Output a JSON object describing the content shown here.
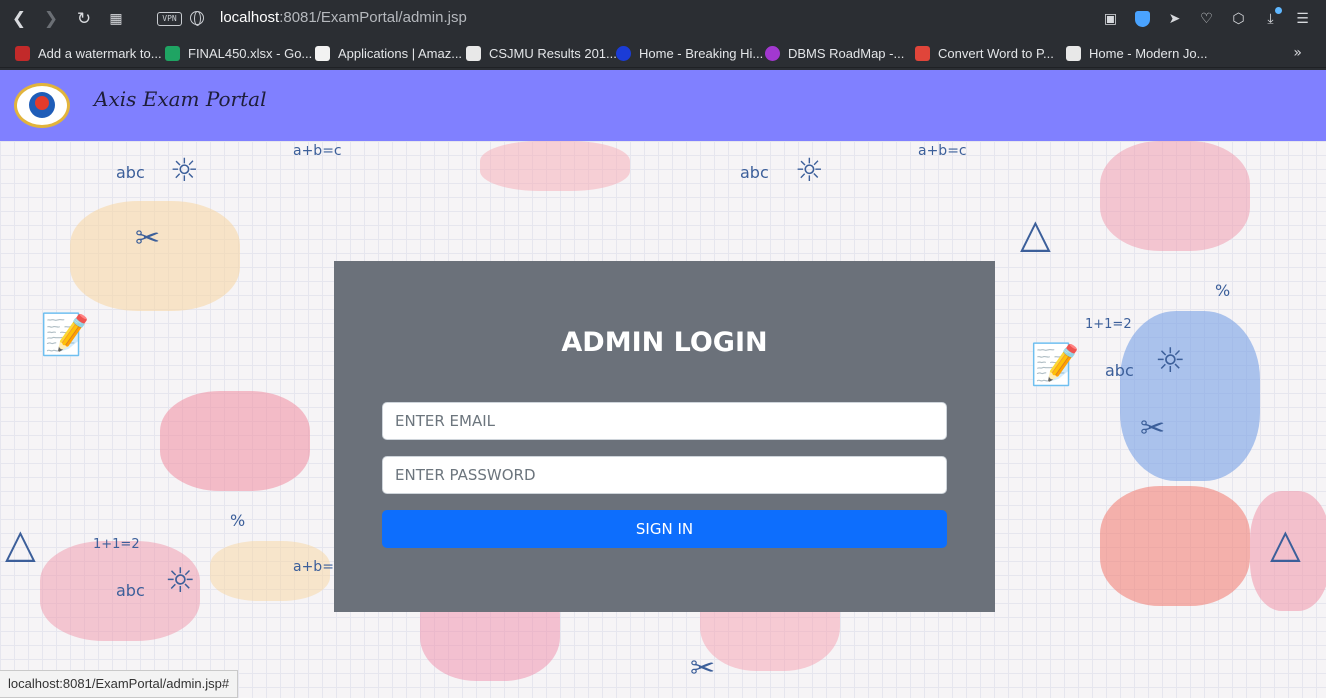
{
  "browser": {
    "url_host": "localhost",
    "url_rest": ":8081/ExamPortal/admin.jsp",
    "vpn_label": "VPN",
    "bookmarks": [
      {
        "label": "Add a watermark to...",
        "icon_color": "#c22a2a"
      },
      {
        "label": "FINAL450.xlsx - Go...",
        "icon_color": "#1fa463"
      },
      {
        "label": "Applications | Amaz...",
        "icon_color": "#f2f2f2"
      },
      {
        "label": "CSJMU Results 201...",
        "icon_color": "#e8e8e8"
      },
      {
        "label": "Home - Breaking Hi...",
        "icon_color": "#1b3cd6"
      },
      {
        "label": "DBMS RoadMap -...",
        "icon_color": "#a238d0"
      },
      {
        "label": "Convert Word to P...",
        "icon_color": "#e0453a"
      },
      {
        "label": "Home - Modern Jo...",
        "icon_color": "#e8e8e8"
      }
    ],
    "more_label": "»"
  },
  "navbar": {
    "brand": "Axis Exam Portal",
    "bg_color": "#8080ff"
  },
  "login": {
    "title": "ADMIN LOGIN",
    "email_placeholder": "ENTER EMAIL",
    "password_placeholder": "ENTER PASSWORD",
    "submit_label": "SIGN IN",
    "button_color": "#0d6efd"
  },
  "status_bar": {
    "text": "localhost:8081/ExamPortal/admin.jsp#"
  }
}
